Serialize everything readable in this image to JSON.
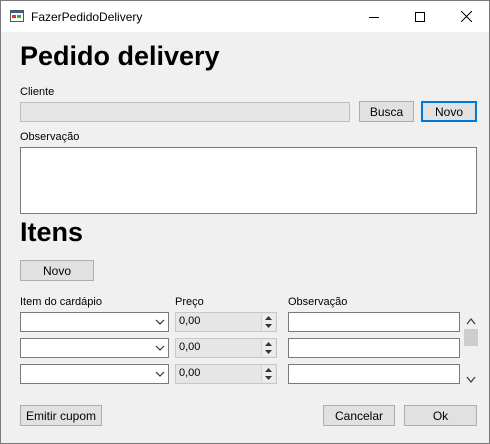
{
  "window": {
    "title": "FazerPedidoDelivery"
  },
  "header": {
    "title": "Pedido delivery"
  },
  "cliente": {
    "label": "Cliente",
    "value": "",
    "busca_label": "Busca",
    "novo_label": "Novo"
  },
  "observacao": {
    "label": "Observação",
    "value": ""
  },
  "itens": {
    "title": "Itens",
    "novo_label": "Novo",
    "col_item": "Item do cardápio",
    "col_preco": "Preço",
    "col_obs": "Observação",
    "rows": [
      {
        "item": "",
        "preco": "0,00",
        "obs": ""
      },
      {
        "item": "",
        "preco": "0,00",
        "obs": ""
      },
      {
        "item": "",
        "preco": "0,00",
        "obs": ""
      }
    ]
  },
  "footer": {
    "cupom_label": "Emitir cupom",
    "cancelar_label": "Cancelar",
    "ok_label": "Ok"
  },
  "colors": {
    "accent": "#0078d7",
    "window_bg": "#f0f0f0"
  }
}
